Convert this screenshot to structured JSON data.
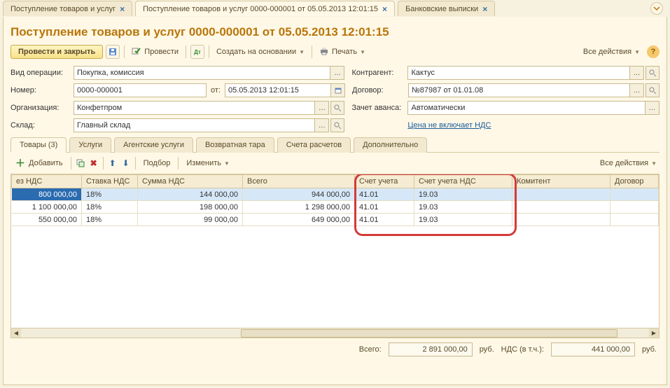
{
  "tabs": [
    {
      "label": "Поступление товаров и услуг"
    },
    {
      "label": "Поступление товаров и услуг 0000-000001 от 05.05.2013 12:01:15",
      "active": true
    },
    {
      "label": "Банковские выписки"
    }
  ],
  "title": "Поступление товаров и услуг 0000-000001 от 05.05.2013 12:01:15",
  "toolbar": {
    "submit": "Провести и закрыть",
    "post": "Провести",
    "create_based": "Создать на основании",
    "print": "Печать",
    "all_actions": "Все действия"
  },
  "form": {
    "labels": {
      "operation": "Вид операции:",
      "number": "Номер:",
      "from": "от:",
      "org": "Организация:",
      "warehouse": "Склад:",
      "contractor": "Контрагент:",
      "contract": "Договор:",
      "advance": "Зачет аванса:"
    },
    "operation": "Покупка, комиссия",
    "number": "0000-000001",
    "date": "05.05.2013 12:01:15",
    "org": "Конфетпром",
    "warehouse": "Главный склад",
    "contractor": "Кактус",
    "contract": "№87987 от 01.01.08",
    "advance": "Автоматически",
    "price_link": "Цена не включает НДС"
  },
  "doctabs": [
    "Товары (3)",
    "Услуги",
    "Агентские услуги",
    "Возвратная тара",
    "Счета расчетов",
    "Дополнительно"
  ],
  "tabletb": {
    "add": "Добавить",
    "selection": "Подбор",
    "edit": "Изменить"
  },
  "columns": [
    "ез НДС",
    "Ставка НДС",
    "Сумма НДС",
    "Всего",
    "Счет учета",
    "Счет учета НДС",
    "Комитент",
    "Договор"
  ],
  "rows": [
    {
      "sum": "800 000,00",
      "rate": "18%",
      "vat": "144 000,00",
      "total": "944 000,00",
      "acc": "41.01",
      "accvat": "19.03",
      "kom": "",
      "dog": ""
    },
    {
      "sum": "1 100 000,00",
      "rate": "18%",
      "vat": "198 000,00",
      "total": "1 298 000,00",
      "acc": "41.01",
      "accvat": "19.03",
      "kom": "",
      "dog": ""
    },
    {
      "sum": "550 000,00",
      "rate": "18%",
      "vat": "99 000,00",
      "total": "649 000,00",
      "acc": "41.01",
      "accvat": "19.03",
      "kom": "",
      "dog": ""
    }
  ],
  "footer": {
    "total_label": "Всего:",
    "total": "2 891 000,00",
    "cur1": "руб.",
    "vat_label": "НДС (в т.ч.):",
    "vat": "441 000,00",
    "cur2": "руб."
  }
}
